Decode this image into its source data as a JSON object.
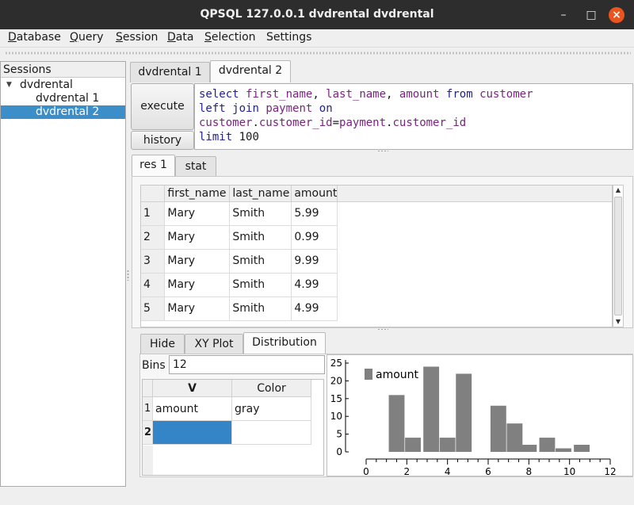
{
  "window": {
    "title": "QPSQL 127.0.0.1 dvdrental dvdrental",
    "controls": {
      "minimize": "–",
      "maximize": "□",
      "close": "×"
    }
  },
  "menu": [
    {
      "label": "atabase",
      "mnemonic": "D"
    },
    {
      "label": "uery",
      "mnemonic": "Q"
    },
    {
      "label": "ession",
      "mnemonic": "S"
    },
    {
      "label": "ata",
      "mnemonic": "D"
    },
    {
      "label": "election",
      "mnemonic": "S"
    },
    {
      "label": "Settings",
      "mnemonic": ""
    }
  ],
  "sessions": {
    "header": "Sessions",
    "root": "dvdrental",
    "items": [
      "dvdrental 1",
      "dvdrental 2"
    ],
    "selected_index": 1
  },
  "editor_tabs": [
    "dvdrental 1",
    "dvdrental 2"
  ],
  "editor": {
    "execute_label": "execute",
    "history_label": "history",
    "sql_lines": [
      [
        [
          "kw",
          "select"
        ],
        [
          "t",
          " "
        ],
        [
          "id",
          "first_name"
        ],
        [
          "t",
          ", "
        ],
        [
          "id",
          "last_name"
        ],
        [
          "t",
          ", "
        ],
        [
          "id",
          "amount"
        ],
        [
          "t",
          " "
        ],
        [
          "kw",
          "from"
        ],
        [
          "t",
          " "
        ],
        [
          "id",
          "customer"
        ]
      ],
      [
        [
          "kw",
          "left"
        ],
        [
          "t",
          " "
        ],
        [
          "kw",
          "join"
        ],
        [
          "t",
          " "
        ],
        [
          "id",
          "payment"
        ],
        [
          "t",
          " "
        ],
        [
          "kw",
          "on"
        ]
      ],
      [
        [
          "id",
          "customer"
        ],
        [
          "t",
          "."
        ],
        [
          "id",
          "customer_id"
        ],
        [
          "t",
          "="
        ],
        [
          "id",
          "payment"
        ],
        [
          "t",
          "."
        ],
        [
          "id",
          "customer_id"
        ]
      ],
      [
        [
          "kw",
          "limit"
        ],
        [
          "t",
          " 100"
        ]
      ]
    ]
  },
  "result_tabs": [
    "res 1",
    "stat"
  ],
  "result": {
    "columns": [
      "first_name",
      "last_name",
      "amount"
    ],
    "rows": [
      [
        "1",
        "Mary",
        "Smith",
        "5.99"
      ],
      [
        "2",
        "Mary",
        "Smith",
        "0.99"
      ],
      [
        "3",
        "Mary",
        "Smith",
        "9.99"
      ],
      [
        "4",
        "Mary",
        "Smith",
        "4.99"
      ],
      [
        "5",
        "Mary",
        "Smith",
        "4.99"
      ]
    ]
  },
  "analysis_tabs": [
    "Hide",
    "XY Plot",
    "Distribution"
  ],
  "distribution": {
    "bins_label": "Bins",
    "bins_value": "12",
    "table_headers": [
      "V",
      "Color"
    ],
    "rows": [
      {
        "num": "1",
        "v": "amount",
        "color": "gray"
      },
      {
        "num": "2",
        "v": "",
        "color": ""
      }
    ]
  },
  "chart_data": {
    "type": "bar",
    "title": "",
    "xlabel": "",
    "ylabel": "",
    "xlim": [
      0,
      12
    ],
    "ylim": [
      0,
      25
    ],
    "x_ticks": [
      0,
      2,
      4,
      6,
      8,
      10,
      12
    ],
    "y_ticks": [
      0,
      5,
      10,
      15,
      20,
      25
    ],
    "bar_color": "#808080",
    "legend": "top-left",
    "series": [
      {
        "name": "amount",
        "x": [
          1.5,
          2.3,
          3.2,
          4.0,
          4.8,
          6.5,
          7.3,
          8.0,
          8.9,
          9.7,
          10.6
        ],
        "values": [
          16,
          4,
          24,
          4,
          22,
          13,
          8,
          2,
          4,
          1,
          2
        ]
      }
    ]
  }
}
